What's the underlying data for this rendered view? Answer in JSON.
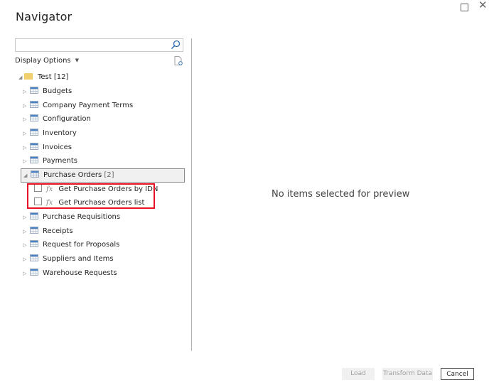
{
  "window": {
    "title": "Navigator",
    "maximize_icon": "maximize-icon",
    "close_icon": "close-icon"
  },
  "search": {
    "value": "",
    "placeholder": "",
    "icon": "search-icon"
  },
  "display_options": {
    "label": "Display Options",
    "caret": "▼",
    "refresh_icon": "refresh-document-icon"
  },
  "tree": {
    "root": {
      "label": "Test [12]",
      "expanded": true,
      "icon": "folder-icon"
    },
    "items": [
      {
        "label": "Budgets",
        "expanded": false
      },
      {
        "label": "Company Payment Terms",
        "expanded": false
      },
      {
        "label": "Configuration",
        "expanded": false
      },
      {
        "label": "Inventory",
        "expanded": false
      },
      {
        "label": "Invoices",
        "expanded": false
      },
      {
        "label": "Payments",
        "expanded": false
      },
      {
        "label": "Purchase Orders",
        "count": "[2]",
        "expanded": true,
        "selected": true,
        "children": [
          {
            "label": "Get Purchase Orders by IDN",
            "checked": false,
            "icon": "function-icon",
            "glyph": "fx"
          },
          {
            "label": "Get Purchase Orders list",
            "checked": false,
            "icon": "function-icon",
            "glyph": "fx"
          }
        ]
      },
      {
        "label": "Purchase Requisitions",
        "expanded": false
      },
      {
        "label": "Receipts",
        "expanded": false
      },
      {
        "label": "Request for Proposals",
        "expanded": false
      },
      {
        "label": "Suppliers and Items",
        "expanded": false
      },
      {
        "label": "Warehouse Requests",
        "expanded": false
      }
    ]
  },
  "preview": {
    "message": "No items selected for preview"
  },
  "footer": {
    "load_label": "Load",
    "transform_label": "Transform Data",
    "cancel_label": "Cancel"
  },
  "colors": {
    "highlight_box": "#e81123",
    "folder": "#f2cf6e",
    "table_header": "#4a82c3"
  }
}
